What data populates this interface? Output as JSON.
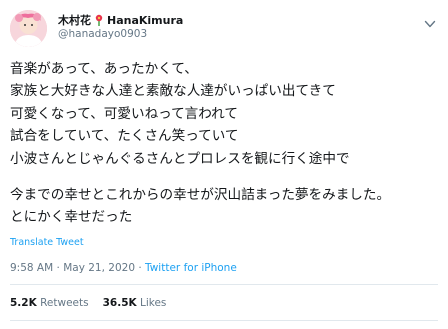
{
  "user": {
    "name": "木村花",
    "display_suffix": "HanaKimura",
    "handle": "@hanadayo0903"
  },
  "tweet": {
    "lines": [
      "音楽があって、あったかくて、",
      "家族と大好きな人達と素敵な人達がいっぱい出てきて",
      "可愛くなって、可愛いねって言われて",
      "試合をしていて、たくさん笑っていて",
      "小波さんとじゃんぐるさんとプロレスを観に行く途中で",
      "今までの幸せとこれからの幸せが沢山詰まった夢をみました。",
      "とにかく幸せだった"
    ],
    "translate_label": "Translate Tweet"
  },
  "meta": {
    "time": "9:58 AM",
    "separator": "·",
    "date": "May 21, 2020",
    "source": "Twitter for iPhone"
  },
  "stats": {
    "retweets_count": "5.2K",
    "retweets_label": "Retweets",
    "likes_count": "36.5K",
    "likes_label": "Likes"
  },
  "icons": {
    "name_emoji": "flower-icon",
    "menu": "chevron-down-icon"
  },
  "colors": {
    "link_blue": "#1da1f2",
    "secondary_text": "#657786",
    "primary_text": "#14171a",
    "divider": "#e1e8ed"
  }
}
